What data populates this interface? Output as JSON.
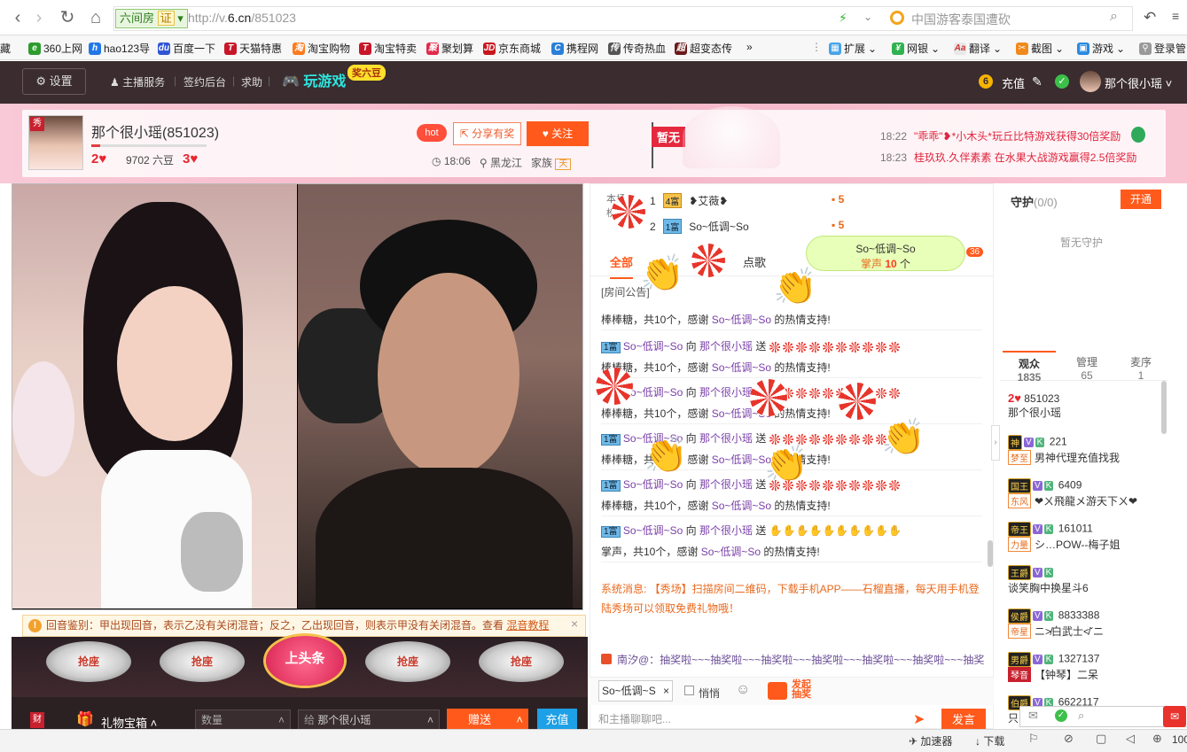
{
  "browser": {
    "site_badge": "六间房",
    "site_badge_cert": "证",
    "url_prefix": "http://v.",
    "url_domain": "6.cn",
    "url_path": "/851023",
    "search_text": "中国游客泰国遭砍",
    "bookmarks": [
      "藏",
      "360上网",
      "hao123导",
      "百度一下",
      "天猫特惠",
      "淘宝购物",
      "淘宝特卖",
      "聚划算",
      "京东商城",
      "携程网",
      "传奇热血",
      "超变态传"
    ],
    "bookmarks_more": "»",
    "extensions": [
      "扩展",
      "网银",
      "翻译",
      "截图",
      "游戏",
      "登录管"
    ]
  },
  "sitenav": {
    "settings": "设置",
    "host_service": "主播服务",
    "sign_in": "签约后台",
    "help": "求助",
    "play_games": "玩游戏",
    "games_badge": "奖六豆",
    "recharge": "充值",
    "username": "那个很小瑶"
  },
  "host": {
    "name": "那个很小瑶(851023)",
    "level_left": "2",
    "beans": "9702 六豆",
    "level_right": "3",
    "hot": "hot",
    "share": "分享有奖",
    "follow": "关注",
    "time": "18:06",
    "location": "黑龙江",
    "family_label": "家族",
    "family_tag": "天",
    "rank_flag": "暂无",
    "logo_text": "秀"
  },
  "news": [
    {
      "time": "18:22",
      "text": "\"乖乖\"❥*小木头*玩丘比特游戏获得30倍奖励"
    },
    {
      "time": "18:23",
      "text": "桂玖玖.久伴素素 在水果大战游戏赢得2.5倍奖励"
    }
  ],
  "echo_notice": {
    "text": "回音鉴别：甲出现回音，表示乙没有关闭混音；反之，乙出现回音，则表示甲没有关闭混音。查看",
    "link": "混音教程",
    "close": "×"
  },
  "seats": [
    "抢座",
    "抢座",
    "抢座",
    "抢座"
  ],
  "top_seat": "上头条",
  "gift": {
    "label": "礼物宝箱",
    "qty_placeholder": "数量",
    "to_prefix": "给",
    "to_name": "那个很小瑶",
    "send": "赠送",
    "recharge": "充值"
  },
  "rank": {
    "label_top": "本场",
    "label_bottom": "榜",
    "rows": [
      {
        "idx": "1",
        "wealth": "4富",
        "name": "❥艾薇❥",
        "value": "5"
      },
      {
        "idx": "2",
        "wealth": "1富",
        "name": "So~低调~So",
        "value": "5"
      }
    ]
  },
  "chat_tabs": {
    "all": "全部",
    "song": "点歌",
    "count": "36"
  },
  "applaud": {
    "name": "So~低调~So",
    "label": "掌声",
    "count": "10",
    "unit": "个"
  },
  "room_notice": "[房间公告]",
  "messages": [
    {
      "pre": "",
      "user": "",
      "to": "",
      "host": "",
      "send": "",
      "body": "棒棒糖，共10个，感谢",
      "who": "So~低调~So",
      "tail": "的热情支持!"
    },
    {
      "pre": "1富",
      "user": "So~低调~So",
      "to": "向",
      "host": "那个很小瑶",
      "send": "送",
      "body": "棒棒糖，共10个，感谢",
      "who": "So~低调~So",
      "tail": "的热情支持!"
    },
    {
      "pre": "1富",
      "user": "So~低调~So",
      "to": "向",
      "host": "那个很小瑶",
      "send": "送",
      "body": "棒棒糖，共10个，感谢",
      "who": "So~低调~So",
      "tail": "的热情支持!"
    },
    {
      "pre": "1富",
      "user": "So~低调~So",
      "to": "向",
      "host": "那个很小瑶",
      "send": "送",
      "body": "棒棒糖，共10个，感谢",
      "who": "So~低调~So",
      "tail": "的热情支持!"
    },
    {
      "pre": "1富",
      "user": "So~低调~So",
      "to": "向",
      "host": "那个很小瑶",
      "send": "送",
      "body": "棒棒糖，共10个，感谢",
      "who": "So~低调~So",
      "tail": "的热情支持!"
    },
    {
      "pre": "1富",
      "user": "So~低调~So",
      "to": "向",
      "host": "那个很小瑶",
      "send": "送",
      "body": "掌声，共10个，感谢",
      "who": "So~低调~So",
      "tail": "的热情支持!"
    }
  ],
  "system_msg": "系统消息: 【秀场】扫描房间二维码，下载手机APP——石榴直播，每天用手机登陆秀场可以领取免费礼物哦！",
  "lottery_msg": "南汐@：抽奖啦~~~抽奖啦~~~抽奖啦~~~抽奖啦~~~抽奖啦~~~抽奖啦~~~抽奖",
  "chat_footer": {
    "to": "So~低调~S",
    "to_close": "×",
    "private": "悄悄",
    "launch_top": "发起",
    "launch_bottom": "抽奖",
    "placeholder": "和主播聊聊吧...",
    "send": "发言"
  },
  "guard": {
    "title": "守护",
    "count": "(0/0)",
    "open": "开通",
    "empty": "暂无守护"
  },
  "audience_tabs": [
    {
      "label": "观众",
      "count": "1835"
    },
    {
      "label": "管理",
      "count": "65"
    },
    {
      "label": "麦序",
      "count": "1"
    }
  ],
  "audience": [
    {
      "rank": "",
      "id": "851023",
      "tag": "",
      "name": "那个很小瑶"
    },
    {
      "rank": "神",
      "id": "221",
      "tag": "梦至",
      "name": "男神代理充值找我"
    },
    {
      "rank": "国王",
      "id": "6409",
      "tag": "东风",
      "name": "❤ㄨ飛龍メ游天下ㄨ❤"
    },
    {
      "rank": "帝王",
      "id": "161011",
      "tag": "力量",
      "name": "シ…POW--梅子姐"
    },
    {
      "rank": "王爵",
      "id": "",
      "tag": "",
      "name": "谈笑胸中换星斗6"
    },
    {
      "rank": "侯爵",
      "id": "8833388",
      "tag": "帝星",
      "name": "ニ≯白武士≮ˇニ"
    },
    {
      "rank": "男爵",
      "id": "1327137",
      "tag": "琴音",
      "name": "【钟琴】二呆"
    },
    {
      "rank": "伯爵",
      "id": "6622117",
      "tag": "",
      "name": "只"
    }
  ],
  "statusbar": {
    "accelerator": "加速器",
    "download": "下载",
    "zoom": "100"
  },
  "colors": {
    "accent": "#ff5a1c",
    "nav_bg": "#3a2c2f",
    "band": "#f4b7c9"
  }
}
